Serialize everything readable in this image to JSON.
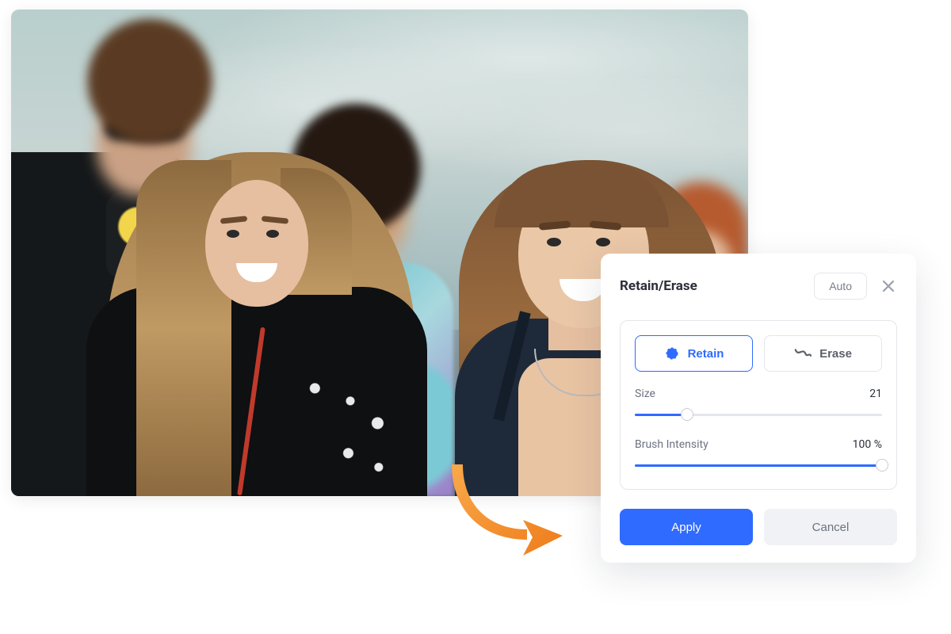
{
  "panel": {
    "title": "Retain/Erase",
    "auto_label": "Auto",
    "modes": {
      "retain": "Retain",
      "erase": "Erase"
    },
    "size": {
      "label": "Size",
      "value": "21",
      "percent": 21
    },
    "brush_intensity": {
      "label": "Brush Intensity",
      "value": "100 %",
      "percent": 100
    },
    "apply_label": "Apply",
    "cancel_label": "Cancel"
  },
  "colors": {
    "accent": "#2f6bff",
    "arrow": "#f7931e"
  }
}
